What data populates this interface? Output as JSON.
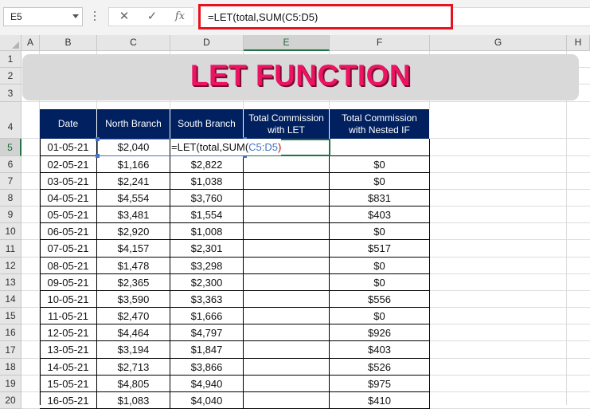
{
  "formula_bar": {
    "name_box": "E5",
    "cancel_icon": "✕",
    "enter_icon": "✓",
    "fx_label": "fx",
    "formula": "=LET(total,SUM(C5:D5)"
  },
  "columns": [
    "A",
    "B",
    "C",
    "D",
    "E",
    "F",
    "G",
    "H"
  ],
  "rows": [
    "1",
    "2",
    "3",
    "4",
    "5",
    "6",
    "7",
    "8",
    "9",
    "10",
    "11",
    "12",
    "13",
    "14",
    "15",
    "16",
    "17",
    "18",
    "19",
    "20"
  ],
  "active_cell": {
    "column": "E",
    "row": "5"
  },
  "title": "LET FUNCTION",
  "table": {
    "headers": [
      "Date",
      "North Branch",
      "South Branch",
      "Total Commission\nwith LET",
      "Total Commission\nwith Nested IF"
    ],
    "editing": {
      "prefix": "=LET(total,SUM(",
      "ref": "C5:D5",
      "suffix": ")"
    },
    "rows": [
      {
        "date": "01-05-21",
        "north": "$2,040",
        "south": "",
        "let": "",
        "nested": ""
      },
      {
        "date": "02-05-21",
        "north": "$1,166",
        "south": "$2,822",
        "let": "",
        "nested": "$0"
      },
      {
        "date": "03-05-21",
        "north": "$2,241",
        "south": "$1,038",
        "let": "",
        "nested": "$0"
      },
      {
        "date": "04-05-21",
        "north": "$4,554",
        "south": "$3,760",
        "let": "",
        "nested": "$831"
      },
      {
        "date": "05-05-21",
        "north": "$3,481",
        "south": "$1,554",
        "let": "",
        "nested": "$403"
      },
      {
        "date": "06-05-21",
        "north": "$2,920",
        "south": "$1,008",
        "let": "",
        "nested": "$0"
      },
      {
        "date": "07-05-21",
        "north": "$4,157",
        "south": "$2,301",
        "let": "",
        "nested": "$517"
      },
      {
        "date": "08-05-21",
        "north": "$1,478",
        "south": "$3,298",
        "let": "",
        "nested": "$0"
      },
      {
        "date": "09-05-21",
        "north": "$2,365",
        "south": "$2,300",
        "let": "",
        "nested": "$0"
      },
      {
        "date": "10-05-21",
        "north": "$3,590",
        "south": "$3,363",
        "let": "",
        "nested": "$556"
      },
      {
        "date": "11-05-21",
        "north": "$2,470",
        "south": "$1,666",
        "let": "",
        "nested": "$0"
      },
      {
        "date": "12-05-21",
        "north": "$4,464",
        "south": "$4,797",
        "let": "",
        "nested": "$926"
      },
      {
        "date": "13-05-21",
        "north": "$3,194",
        "south": "$1,847",
        "let": "",
        "nested": "$403"
      },
      {
        "date": "14-05-21",
        "north": "$2,713",
        "south": "$3,866",
        "let": "",
        "nested": "$526"
      },
      {
        "date": "15-05-21",
        "north": "$4,805",
        "south": "$4,940",
        "let": "",
        "nested": "$975"
      },
      {
        "date": "16-05-21",
        "north": "$1,083",
        "south": "$4,040",
        "let": "",
        "nested": "$410"
      }
    ]
  },
  "colors": {
    "header_fill": "#002060",
    "title_text": "#ec1462",
    "formula_highlight": "#e8121f",
    "reference": "#4472c4",
    "selection": "#217346"
  }
}
